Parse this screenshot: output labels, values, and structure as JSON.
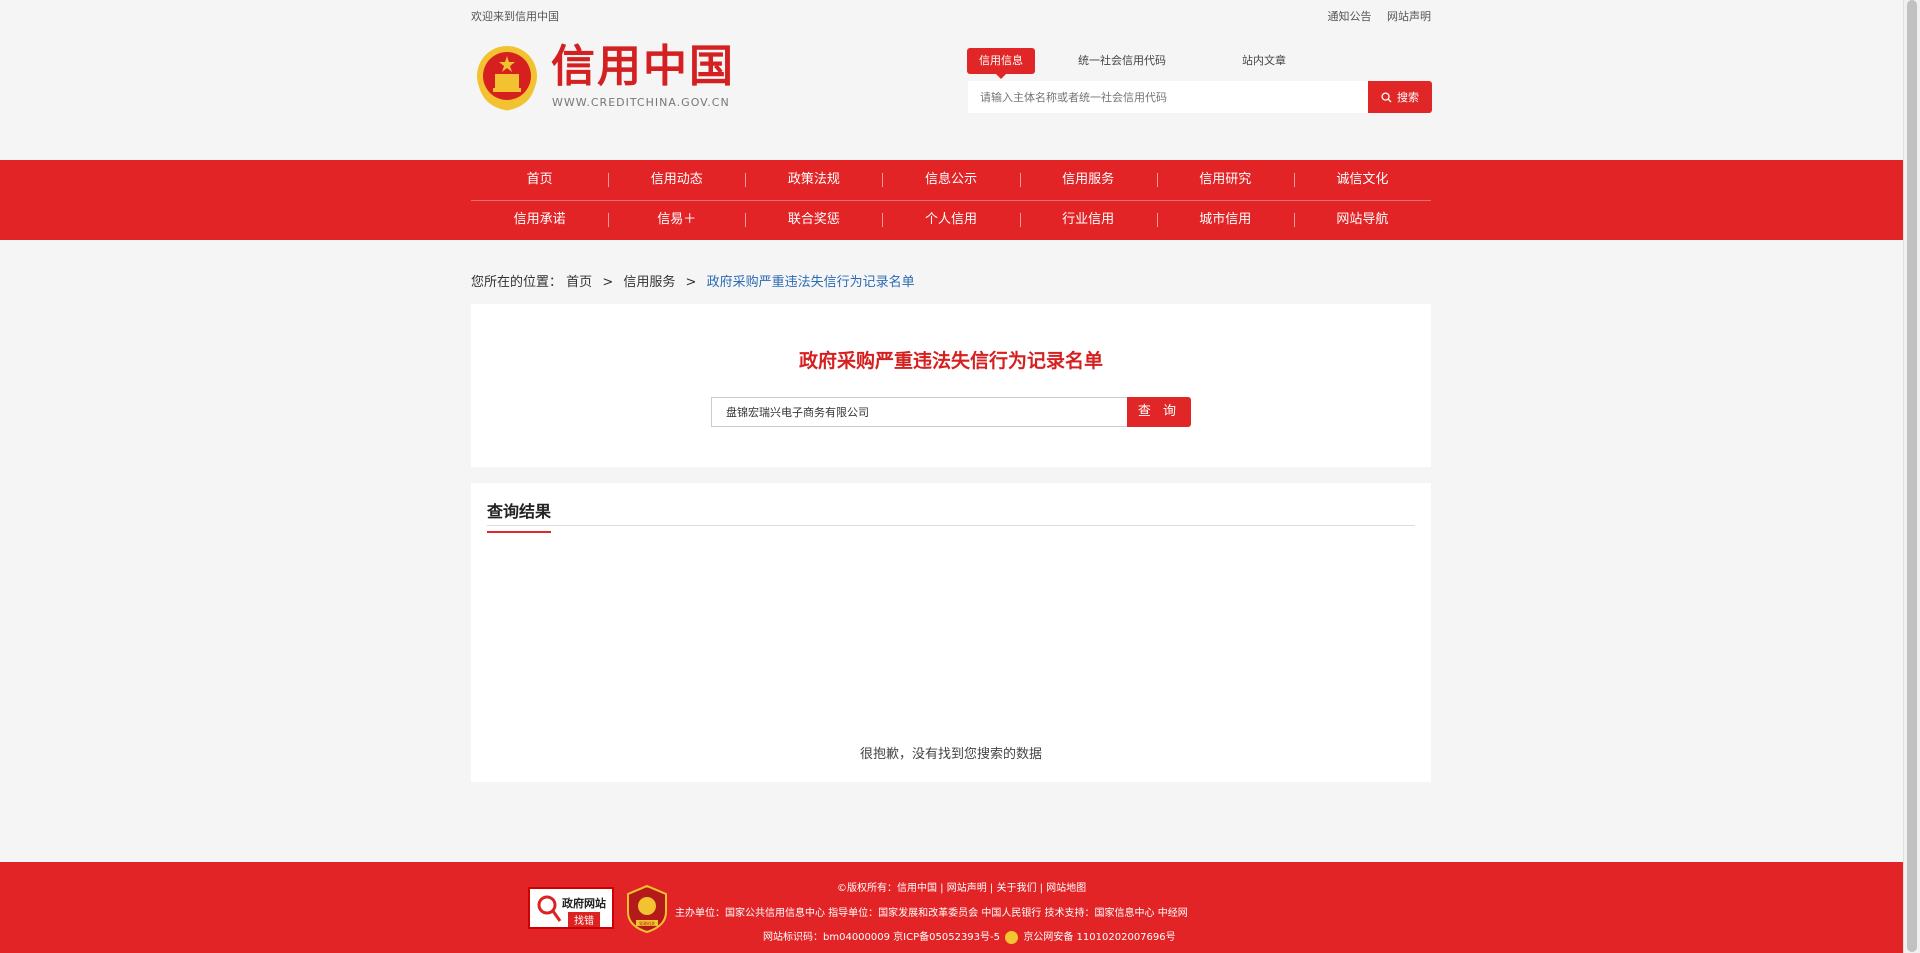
{
  "topbar": {
    "welcome": "欢迎来到信用中国",
    "notice": "通知公告",
    "statement": "网站声明"
  },
  "header": {
    "logo_title": "信用中国",
    "logo_subtitle": "WWW.CREDITCHINA.GOV.CN",
    "search_tabs": [
      "信用信息",
      "统一社会信用代码",
      "站内文章"
    ],
    "search_placeholder": "请输入主体名称或者统一社会信用代码",
    "search_button": "搜索"
  },
  "nav": {
    "row1": [
      "首页",
      "信用动态",
      "政策法规",
      "信息公示",
      "信用服务",
      "信用研究",
      "诚信文化"
    ],
    "row2": [
      "信用承诺",
      "信易＋",
      "联合奖惩",
      "个人信用",
      "行业信用",
      "城市信用",
      "网站导航"
    ]
  },
  "breadcrumb": {
    "prefix": "您所在的位置：",
    "home": "首页",
    "section": "信用服务",
    "current": "政府采购严重违法失信行为记录名单",
    "sep": ">"
  },
  "query": {
    "title": "政府采购严重违法失信行为记录名单",
    "input_value": "盘锦宏瑞兴电子商务有限公司",
    "button": "查 询"
  },
  "result": {
    "title": "查询结果",
    "empty_text": "很抱歉，没有找到您搜索的数据"
  },
  "footer": {
    "line1": "©版权所有：信用中国 | 网站声明 | 关于我们 | 网站地图",
    "line2": "主办单位：国家公共信用信息中心  指导单位：国家发展和改革委员会 中国人民银行  技术支持：国家信息中心 中经网",
    "line3a": "网站标识码：bm04000009  京ICP备05052393号-5",
    "line3b": "京公网安备 11010202007696号",
    "badge1_top": "政府网站",
    "badge1_bottom": "找错",
    "badge2_text": "党政机关"
  },
  "colors": {
    "brand_red": "#e22427",
    "link_blue": "#2a6bb5"
  }
}
